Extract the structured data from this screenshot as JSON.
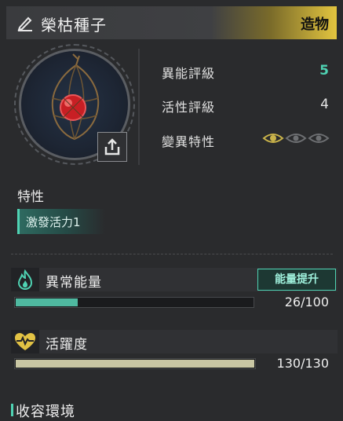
{
  "item": {
    "title": "榮枯種子",
    "category": "造物"
  },
  "stats": {
    "ability_rating_label": "異能評級",
    "ability_rating_value": "5",
    "activity_rating_label": "活性評級",
    "activity_rating_value": "4",
    "mutation_label": "變異特性",
    "mutation_level": 1,
    "mutation_max": 3
  },
  "traits": {
    "title": "特性",
    "items": [
      "激發活力1"
    ]
  },
  "energy": {
    "label": "異常能量",
    "button": "能量提升",
    "current": 26,
    "max": 100,
    "text": "26/100",
    "color": "#4fb9a0"
  },
  "vitality": {
    "label": "活躍度",
    "current": 130,
    "max": 130,
    "text": "130/130",
    "color": "#c9c7a4"
  },
  "containment": {
    "title": "收容環境"
  },
  "colors": {
    "accent": "#4fd3b3",
    "header_gold": "#e3c53f",
    "eye_active": "#c9b34a",
    "eye_inactive": "#6d6f72"
  }
}
